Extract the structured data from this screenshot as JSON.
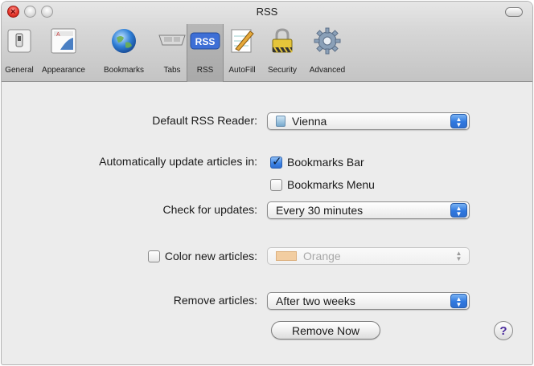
{
  "window": {
    "title": "RSS"
  },
  "toolbar": {
    "items": [
      {
        "label": "General",
        "icon": "general-switch-icon"
      },
      {
        "label": "Appearance",
        "icon": "appearance-icon"
      },
      {
        "label": "Bookmarks",
        "icon": "globe-icon"
      },
      {
        "label": "Tabs",
        "icon": "tabs-icon"
      },
      {
        "label": "RSS",
        "icon": "rss-icon",
        "selected": true
      },
      {
        "label": "AutoFill",
        "icon": "autofill-pencil-icon"
      },
      {
        "label": "Security",
        "icon": "lock-icon"
      },
      {
        "label": "Advanced",
        "icon": "gear-icon"
      }
    ]
  },
  "rss": {
    "default_reader_label": "Default RSS Reader:",
    "default_reader_value": "Vienna",
    "auto_update_label": "Automatically update articles in:",
    "bookmarks_bar_label": "Bookmarks Bar",
    "bookmarks_bar_checked": true,
    "bookmarks_menu_label": "Bookmarks Menu",
    "bookmarks_menu_checked": false,
    "check_updates_label": "Check for updates:",
    "check_updates_value": "Every 30 minutes",
    "color_new_label": "Color new articles:",
    "color_new_checked": false,
    "color_value": "Orange",
    "color_hex": "#f2c793",
    "remove_articles_label": "Remove articles:",
    "remove_articles_value": "After two weeks",
    "remove_now_label": "Remove Now",
    "help_label": "?"
  },
  "colors": {
    "accent": "#3b82e4",
    "help": "#4a2a9c"
  }
}
